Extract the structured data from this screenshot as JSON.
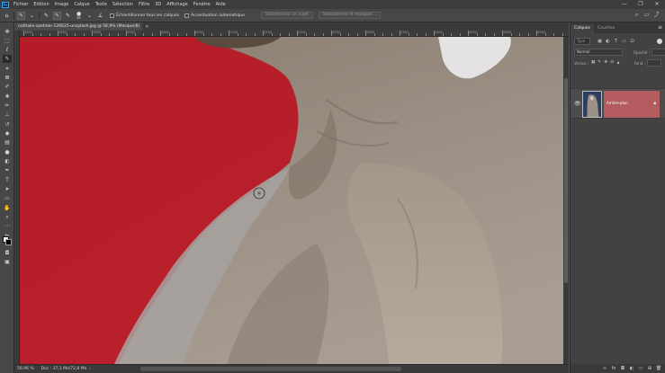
{
  "menu": {
    "items": [
      "Fichier",
      "Edition",
      "Image",
      "Calque",
      "Texte",
      "Sélection",
      "Filtre",
      "3D",
      "Affichage",
      "Fenêtre",
      "Aide"
    ]
  },
  "window_controls": {
    "minimize": "—",
    "restore": "❐",
    "close": "✕"
  },
  "options_bar": {
    "size_value": "85",
    "sample_all_label": "Échantillonner tous les calques",
    "auto_enhance_label": "Accentuation automatique",
    "select_subject_label": "Sélectionner un sujet",
    "select_and_mask_label": "Sélectionner et masquer..."
  },
  "document": {
    "tab_title": "nathalie-spehner-126625-unsplash.jpg @ 56,9% (Masque/8)",
    "zoom": "56,96 %",
    "doc_info": "Doc : 37,1 Mo/72,8 Mo"
  },
  "ruler": {
    "ticks": [
      "1800",
      "1850",
      "1900",
      "1950",
      "2000",
      "2050",
      "2100",
      "2150",
      "2200",
      "2250",
      "2300",
      "2350",
      "2400",
      "2450",
      "2500",
      "2550"
    ]
  },
  "layers_panel": {
    "tabs": [
      "Calques",
      "Couches"
    ],
    "search_placeholder": "Type",
    "blend_mode": "Normal",
    "opacity_label": "Opacité :",
    "lock_label": "Verrou :",
    "fill_label": "Fond :",
    "layer": {
      "name": "Arrière-plan"
    }
  },
  "tools": [
    "move",
    "marquee",
    "lasso",
    "quick-select",
    "crop",
    "frame",
    "eyedropper",
    "healing",
    "brush",
    "stamp",
    "history-brush",
    "eraser",
    "gradient",
    "blur",
    "dodge",
    "pen",
    "text",
    "path-select",
    "rectangle",
    "hand",
    "zoom",
    "more"
  ],
  "colors": {
    "backdrop_red": "#b5202a",
    "backdrop_red_light": "#c52631",
    "dog_fur": "#8f8275",
    "dog_fur_light": "#b7aca0",
    "layer_highlight": "#b35b5f"
  }
}
